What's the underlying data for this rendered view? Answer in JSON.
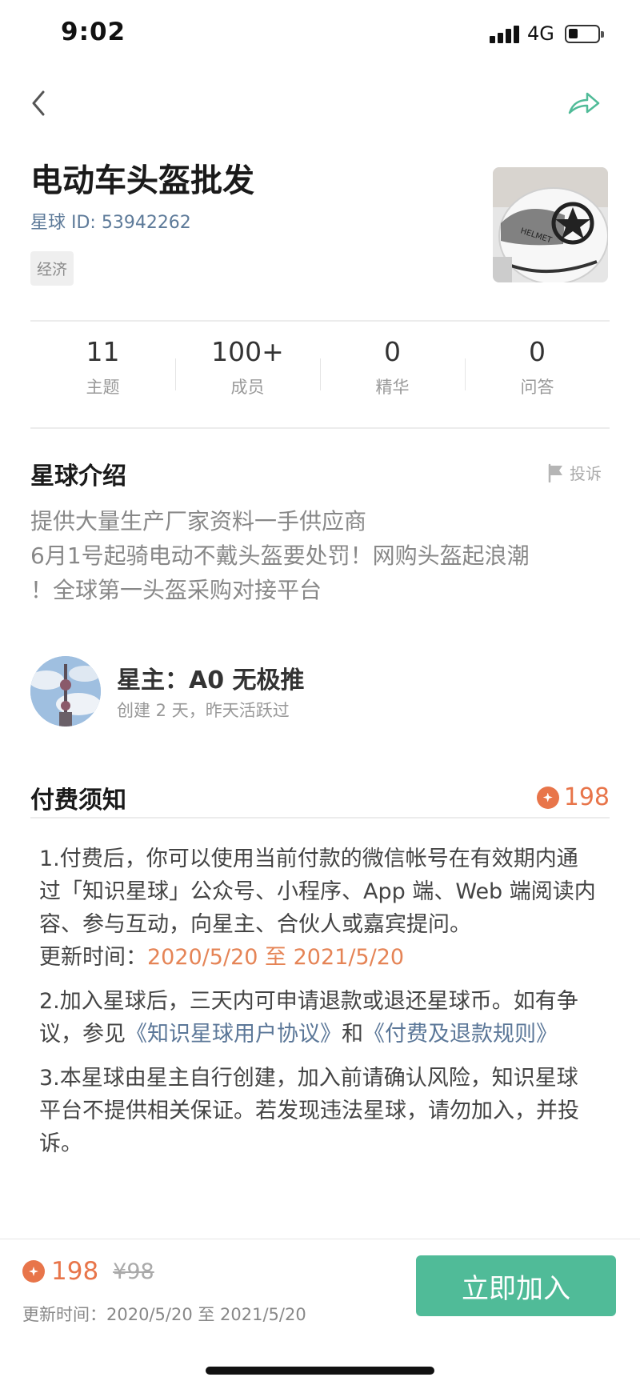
{
  "status_bar": {
    "time": "9:02",
    "network": "4G"
  },
  "header": {
    "title": "电动车头盔批发",
    "planet_id": "星球 ID: 53942262",
    "tag": "经济"
  },
  "stats": [
    {
      "value": "11",
      "label": "主题"
    },
    {
      "value": "100+",
      "label": "成员"
    },
    {
      "value": "0",
      "label": "精华"
    },
    {
      "value": "0",
      "label": "问答"
    }
  ],
  "intro": {
    "title": "星球介绍",
    "report_label": "投诉",
    "lines": [
      "提供大量生产厂家资料一手供应商",
      "6月1号起骑电动不戴头盔要处罚！网购头盔起浪潮",
      "！全球第一头盔采购对接平台"
    ]
  },
  "owner": {
    "name": "星主：A0 无极推",
    "meta": "创建 2 天，昨天活跃过"
  },
  "fee": {
    "title": "付费须知",
    "price": "198",
    "notice_1": "1.付费后，你可以使用当前付款的微信帐号在有效期内通过「知识星球」公众号、小程序、App 端、Web 端阅读内容、参与互动，向星主、合伙人或嘉宾提问。",
    "update_label": "更新时间：",
    "update_range": "2020/5/20 至 2021/5/20",
    "notice_2_prefix": "2.加入星球后，三天内可申请退款或退还星球币。如有争议，参见",
    "agreement_link": "《知识星球用户协议》",
    "notice_2_mid": "和",
    "refund_link": "《付费及退款规则》",
    "notice_3": "3.本星球由星主自行创建，加入前请确认风险，知识星球平台不提供相关保证。若发现违法星球，请勿加入，并投诉。"
  },
  "bottom_bar": {
    "price": "198",
    "old_price": "¥98",
    "update": "更新时间：2020/5/20 至 2021/5/20",
    "join_label": "立即加入"
  },
  "colors": {
    "accent_green": "#50bb98",
    "price_orange": "#e8754a",
    "link_blue": "#5b7798"
  }
}
